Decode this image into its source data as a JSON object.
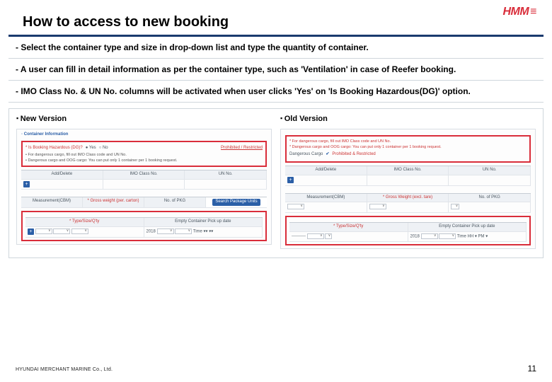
{
  "logo": {
    "text": "HMM",
    "suffix_icon": "≡"
  },
  "title": "How to access to new booking",
  "bullets": [
    "- Select the container type and size in drop-down list and type the quantity of container.",
    "- A user can fill in detail information as per the container type, such as 'Ventilation' in case of Reefer booking.",
    "- IMO Class No. & UN No. columns will be activated when user clicks 'Yes' on 'Is Booking Hazardous(DG)' option."
  ],
  "versions": {
    "new": "New Version",
    "old": "Old Version"
  },
  "new_shot": {
    "header": "◦ Container Information",
    "dg_label": "* Is Booking Hazardous (DG)?",
    "radio_yes": "● Yes",
    "radio_no": "○ No",
    "link": "Prohibited / Restricted",
    "note1": "• For dangerous cargo, fill out IMO Class code and UN No.",
    "note2": "• Dangerous cargo and OOG cargo: You can put only 1 container per 1 booking request.",
    "cols": {
      "adddel": "Add/Delete",
      "imo": "IMO Class No.",
      "un": "UN No."
    },
    "row2": {
      "meas": "Measurement(CBM)",
      "gross": "* Gross weight (per. carton)",
      "pkg": "No. of PKG",
      "btn": "Search Package Units"
    },
    "row3": {
      "type": "* Type/Size/Q'ty",
      "empty": "Empty Container Pick up date"
    },
    "row4": {
      "year": "2018",
      "m1": "▾",
      "m2": "▾",
      "m3": "▾",
      "time": "Time  ▾▾   ▾▾"
    }
  },
  "old_shot": {
    "note1": "* For dangerous cargo, fill out IMO Class code and UN No.",
    "note2": "* Dangerous cargo and OOG cargo: You can put only 1 container per 1 booking request.",
    "dg_label": "Dangerous Cargo",
    "check": "✔",
    "link": "Prohibited & Restricted",
    "cols": {
      "adddel": "Add/Delete",
      "imo": "IMO Class No.",
      "un": "UN No."
    },
    "row2": {
      "meas": "Measurement(CBM)",
      "gross": "* Gross Weight (excl. tare)",
      "pkg": "No. of PKG"
    },
    "row3": {
      "type": "* Type/Size/Q'ty",
      "empty": "Empty Container Pick up date"
    },
    "row4": {
      "opt": "----------",
      "year": "2018",
      "time": "Time  HH ▾  PM ▾"
    }
  },
  "footer": "HYUNDAI MERCHANT MARINE Co., Ltd.",
  "page": "11"
}
